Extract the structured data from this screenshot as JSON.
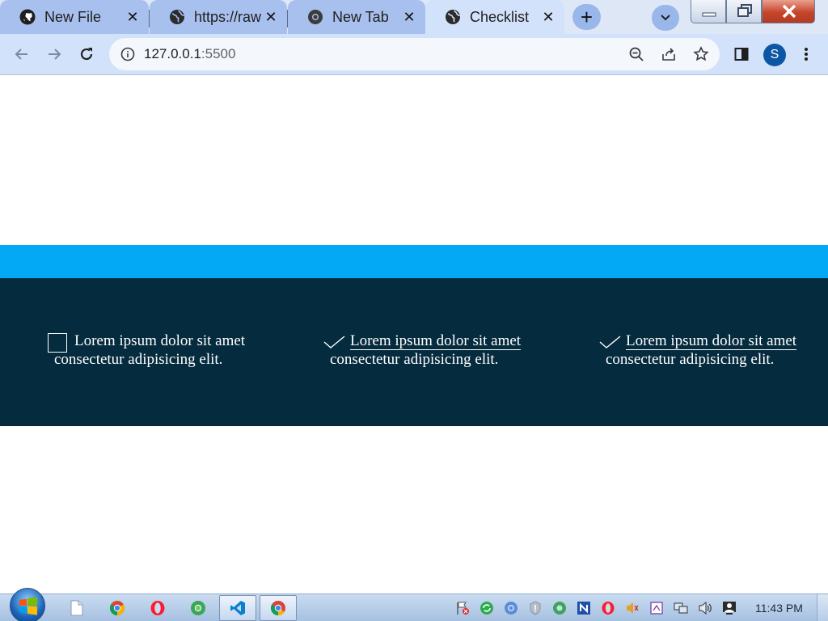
{
  "browser": {
    "tabs": [
      {
        "title": "New File",
        "icon": "github-icon",
        "state": "inactive"
      },
      {
        "title": "https://raw",
        "icon": "globe-icon",
        "state": "inactive"
      },
      {
        "title": "New Tab",
        "icon": "chrome-icon",
        "state": "inactive"
      },
      {
        "title": "Checklist",
        "icon": "globe-icon",
        "state": "active"
      }
    ],
    "new_tab_glyph": "+",
    "close_glyph": "✕",
    "url_host": "127.0.0.1",
    "url_port": ":5500",
    "profile_initial": "S"
  },
  "page": {
    "accent_color": "#03a9f4",
    "panel_color": "#052b3e",
    "items": [
      {
        "line1": "Lorem ipsum dolor sit amet",
        "line2": "consectetur adipisicing elit.",
        "checked": false
      },
      {
        "line1": "Lorem ipsum dolor sit amet",
        "line2": "consectetur adipisicing elit.",
        "checked": true
      },
      {
        "line1": "Lorem ipsum dolor sit amet",
        "line2": "consectetur adipisicing elit.",
        "checked": true
      }
    ]
  },
  "taskbar": {
    "apps": [
      "file-explorer-icon",
      "chrome-icon",
      "opera-icon",
      "chrome-canary-icon",
      "vscode-icon",
      "chrome-icon"
    ],
    "clock": "11:43 PM"
  }
}
